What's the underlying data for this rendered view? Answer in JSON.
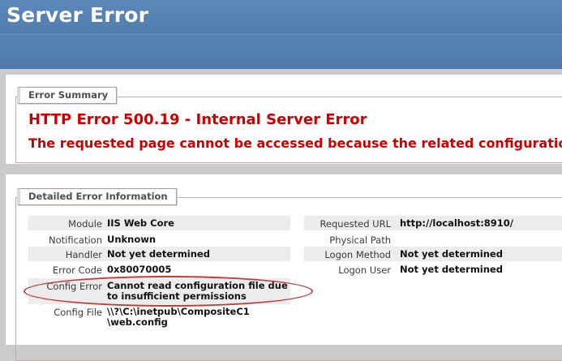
{
  "header": {
    "title": "Server Error"
  },
  "summary": {
    "legend": "Error Summary",
    "heading": "HTTP Error 500.19 - Internal Server Error",
    "message": "The requested page cannot be accessed because the related configuration"
  },
  "details": {
    "legend": "Detailed Error Information",
    "left_rows": [
      {
        "label": "Module",
        "value": "IIS Web Core"
      },
      {
        "label": "Notification",
        "value": "Unknown"
      },
      {
        "label": "Handler",
        "value": "Not yet determined"
      },
      {
        "label": "Error Code",
        "value": "0x80070005"
      },
      {
        "label": "Config Error",
        "value_line1": "Cannot read configuration file due",
        "value_line2": "to insufficient permissions"
      },
      {
        "label": "Config File",
        "value_line1": "\\\\?\\C:\\inetpub\\CompositeC1",
        "value_line2": "\\web.config"
      }
    ],
    "right_rows": [
      {
        "label": "Requested URL",
        "value": "http://localhost:8910/"
      },
      {
        "label": "Physical Path",
        "value": ""
      },
      {
        "label": "Logon Method",
        "value": "Not yet determined"
      },
      {
        "label": "Logon User",
        "value": "Not yet determined"
      }
    ]
  },
  "colors": {
    "header_blue": "#4f7daf",
    "error_red": "#cc0000",
    "highlight_ellipse": "#c33a3a"
  }
}
